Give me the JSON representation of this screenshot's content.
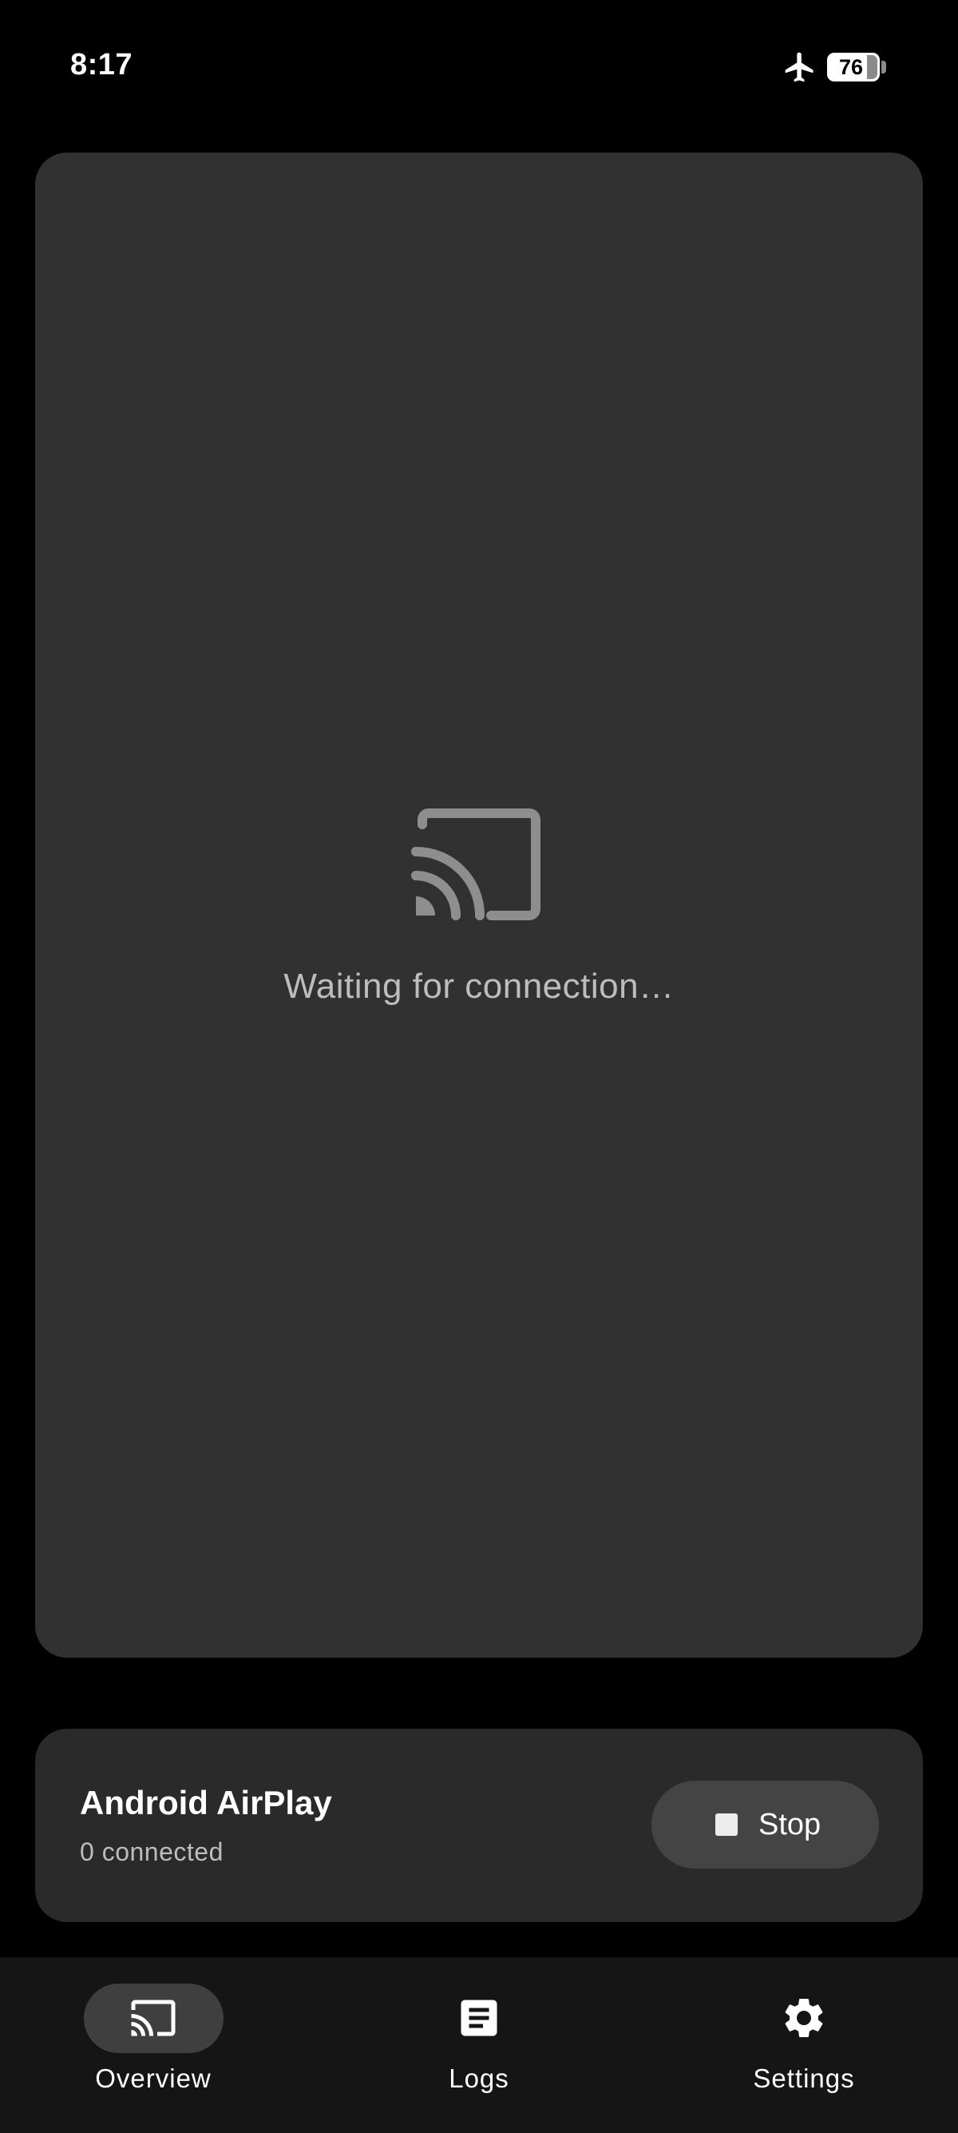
{
  "status_bar": {
    "time": "8:17",
    "battery_level": "76"
  },
  "preview": {
    "icon": "cast-icon",
    "message": "Waiting for connection…"
  },
  "service": {
    "name": "Android AirPlay",
    "connected_count": "0 connected",
    "stop_label": "Stop"
  },
  "nav": {
    "items": [
      {
        "label": "Overview",
        "icon": "cast-icon",
        "selected": true
      },
      {
        "label": "Logs",
        "icon": "document-icon",
        "selected": false
      },
      {
        "label": "Settings",
        "icon": "gear-icon",
        "selected": false
      }
    ]
  },
  "colors": {
    "background": "#000000",
    "preview_card": "#313131",
    "service_card": "#2a2a2a",
    "button": "#444444",
    "nav_background": "#151515",
    "nav_pill": "#3f3f3f",
    "secondary_text": "#bdbdbd",
    "icon_muted": "#8e8e8e"
  }
}
